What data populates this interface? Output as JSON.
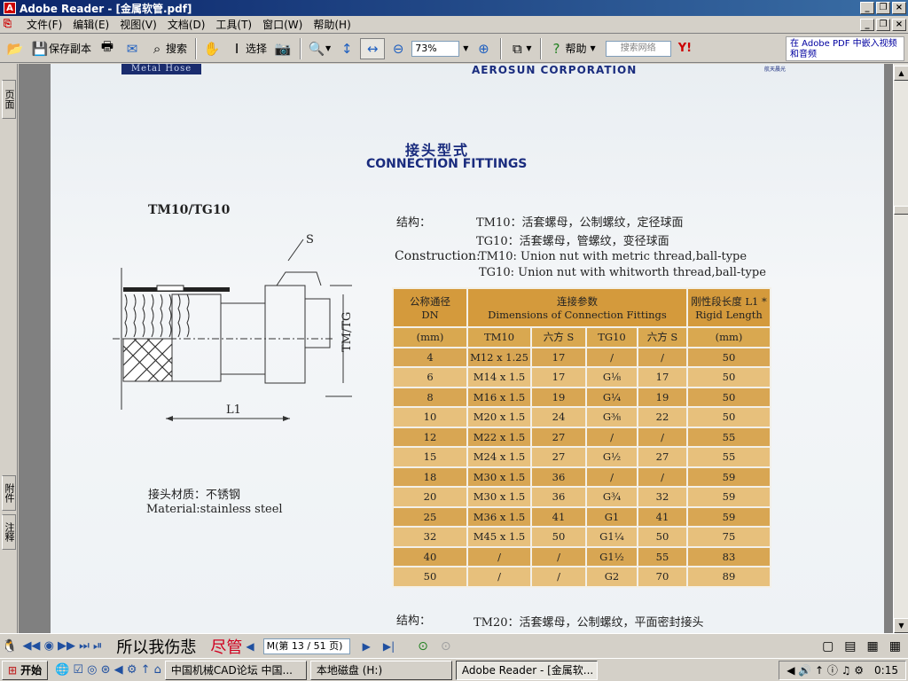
{
  "window": {
    "title": "Adobe Reader - [金属软管.pdf]",
    "app_icon": "adobe-reader-icon",
    "controls": [
      "_",
      "❐",
      "×"
    ]
  },
  "menu": {
    "items": [
      "文件(F)",
      "编辑(E)",
      "视图(V)",
      "文档(D)",
      "工具(T)",
      "窗口(W)",
      "帮助(H)"
    ]
  },
  "toolbar": {
    "save_copy": "保存副本",
    "search": "搜索",
    "select": "选择",
    "zoom": "73%",
    "help": "帮助",
    "search_web_placeholder": "搜索网络",
    "promo": "在 Adobe PDF 中嵌入视频和音频"
  },
  "side_tabs": {
    "pages": "页面",
    "attachments": "附件",
    "comments": "注释"
  },
  "document": {
    "header_left": "Metal Hose",
    "header_center": "AEROSUN CORPORATION",
    "header_right": "航天晨光",
    "title_cn": "接头型式",
    "title_en": "CONNECTION FITTINGS",
    "model": "TM10/TG10",
    "diagram_labels": {
      "s": "S",
      "tm_tg": "TM/TG",
      "l1": "L1"
    },
    "material_cn": "接头材质：不锈钢",
    "material_en": "Material:stainless steel",
    "structure_label": "结构：",
    "structure_tm10": "TM10：活套螺母，公制螺纹，定径球面",
    "structure_tg10": "TG10：活套螺母，管螺纹，变径球面",
    "construction_label": "Construction:",
    "construction_tm10": "TM10: Union nut with metric thread,ball-type",
    "construction_tg10": "TG10: Union nut with whitworth thread,ball-type",
    "next_structure_label": "结构：",
    "next_structure_tm20": "TM20：活套螺母，公制螺纹，平面密封接头",
    "table": {
      "h_dn_cn": "公称通径",
      "h_dn_en": "DN",
      "h_dim_cn": "连接参数",
      "h_dim_en": "Dimensions of Connection Fittings",
      "h_len_cn": "刚性段长度 L1 *",
      "h_len_en": "Rigid Length",
      "sub": [
        "(mm)",
        "TM10",
        "六方 S",
        "TG10",
        "六方 S",
        "(mm)"
      ],
      "rows": [
        [
          "4",
          "M12 x 1.25",
          "17",
          "/",
          "/",
          "50"
        ],
        [
          "6",
          "M14 x 1.5",
          "17",
          "G⅛",
          "17",
          "50"
        ],
        [
          "8",
          "M16 x 1.5",
          "19",
          "G¼",
          "19",
          "50"
        ],
        [
          "10",
          "M20 x 1.5",
          "24",
          "G⅜",
          "22",
          "50"
        ],
        [
          "12",
          "M22 x 1.5",
          "27",
          "/",
          "/",
          "55"
        ],
        [
          "15",
          "M24 x 1.5",
          "27",
          "G½",
          "27",
          "55"
        ],
        [
          "18",
          "M30 x 1.5",
          "36",
          "/",
          "/",
          "59"
        ],
        [
          "20",
          "M30 x 1.5",
          "36",
          "G¾",
          "32",
          "59"
        ],
        [
          "25",
          "M36 x 1.5",
          "41",
          "G1",
          "41",
          "59"
        ],
        [
          "32",
          "M45 x 1.5",
          "50",
          "G1¼",
          "50",
          "75"
        ],
        [
          "40",
          "/",
          "/",
          "G1½",
          "55",
          "83"
        ],
        [
          "50",
          "/",
          "/",
          "G2",
          "70",
          "89"
        ]
      ]
    }
  },
  "statusbar": {
    "ticker": "所以我伤悲",
    "ticker_red": "尽管",
    "page_nav": "M(第 13 / 51 页)"
  },
  "taskbar": {
    "start": "开始",
    "tasks": [
      "中国机械CAD论坛 中国...",
      "本地磁盘 (H:)",
      "Adobe Reader - [金属软..."
    ],
    "clock": "0:15"
  }
}
